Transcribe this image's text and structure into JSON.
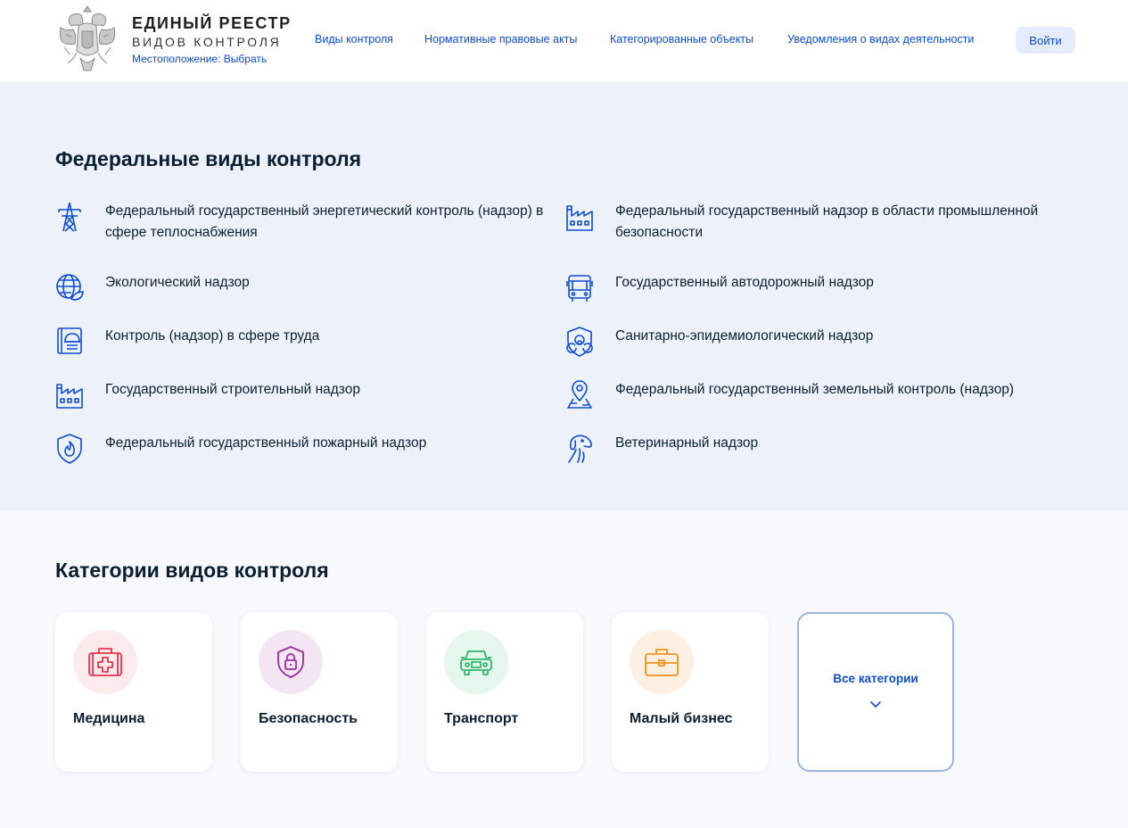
{
  "header": {
    "brand_title": "ЕДИНЫЙ РЕЕСТР",
    "brand_subtitle": "ВИДОВ КОНТРОЛЯ",
    "location": "Местоположение: Выбрать",
    "nav": [
      "Виды контроля",
      "Нормативные правовые акты",
      "Категорированные объекты",
      "Уведомления о видах деятельности"
    ],
    "login": "Войти"
  },
  "federal": {
    "title": "Федеральные виды контроля",
    "items": [
      {
        "label": "Федеральный государственный энергетический контроль (надзор) в сфере теплоснабжения",
        "icon": "power-tower-icon"
      },
      {
        "label": "Федеральный государственный надзор в области промышленной безопасности",
        "icon": "factory-icon"
      },
      {
        "label": "Экологический надзор",
        "icon": "eco-globe-icon"
      },
      {
        "label": "Государственный автодорожный надзор",
        "icon": "bus-icon"
      },
      {
        "label": "Контроль (надзор) в сфере труда",
        "icon": "worker-helmet-icon"
      },
      {
        "label": "Санитарно-эпидемиологический надзор",
        "icon": "biohazard-shield-icon"
      },
      {
        "label": "Государственный строительный надзор",
        "icon": "factory-icon"
      },
      {
        "label": "Федеральный государственный земельный контроль (надзор)",
        "icon": "map-pin-icon"
      },
      {
        "label": "Федеральный государственный пожарный надзор",
        "icon": "fire-shield-icon"
      },
      {
        "label": "Ветеринарный надзор",
        "icon": "dog-icon"
      }
    ]
  },
  "categories": {
    "title": "Категории видов контроля",
    "items": [
      {
        "label": "Медицина",
        "icon": "medkit-icon",
        "color": "#e8334f",
        "bg": "#fdeaed"
      },
      {
        "label": "Безопасность",
        "icon": "lock-shield-icon",
        "color": "#9e2aa0",
        "bg": "#f3e6f2"
      },
      {
        "label": "Транспорт",
        "icon": "car-icon",
        "color": "#2fb86a",
        "bg": "#e5f6ec"
      },
      {
        "label": "Малый бизнес",
        "icon": "briefcase-icon",
        "color": "#f3921b",
        "bg": "#fdf0e2"
      }
    ],
    "all": "Все категории"
  },
  "colors": {
    "accent": "#0d4cd3",
    "section_bg": "#edf2fa",
    "text": "#0b1f33"
  }
}
